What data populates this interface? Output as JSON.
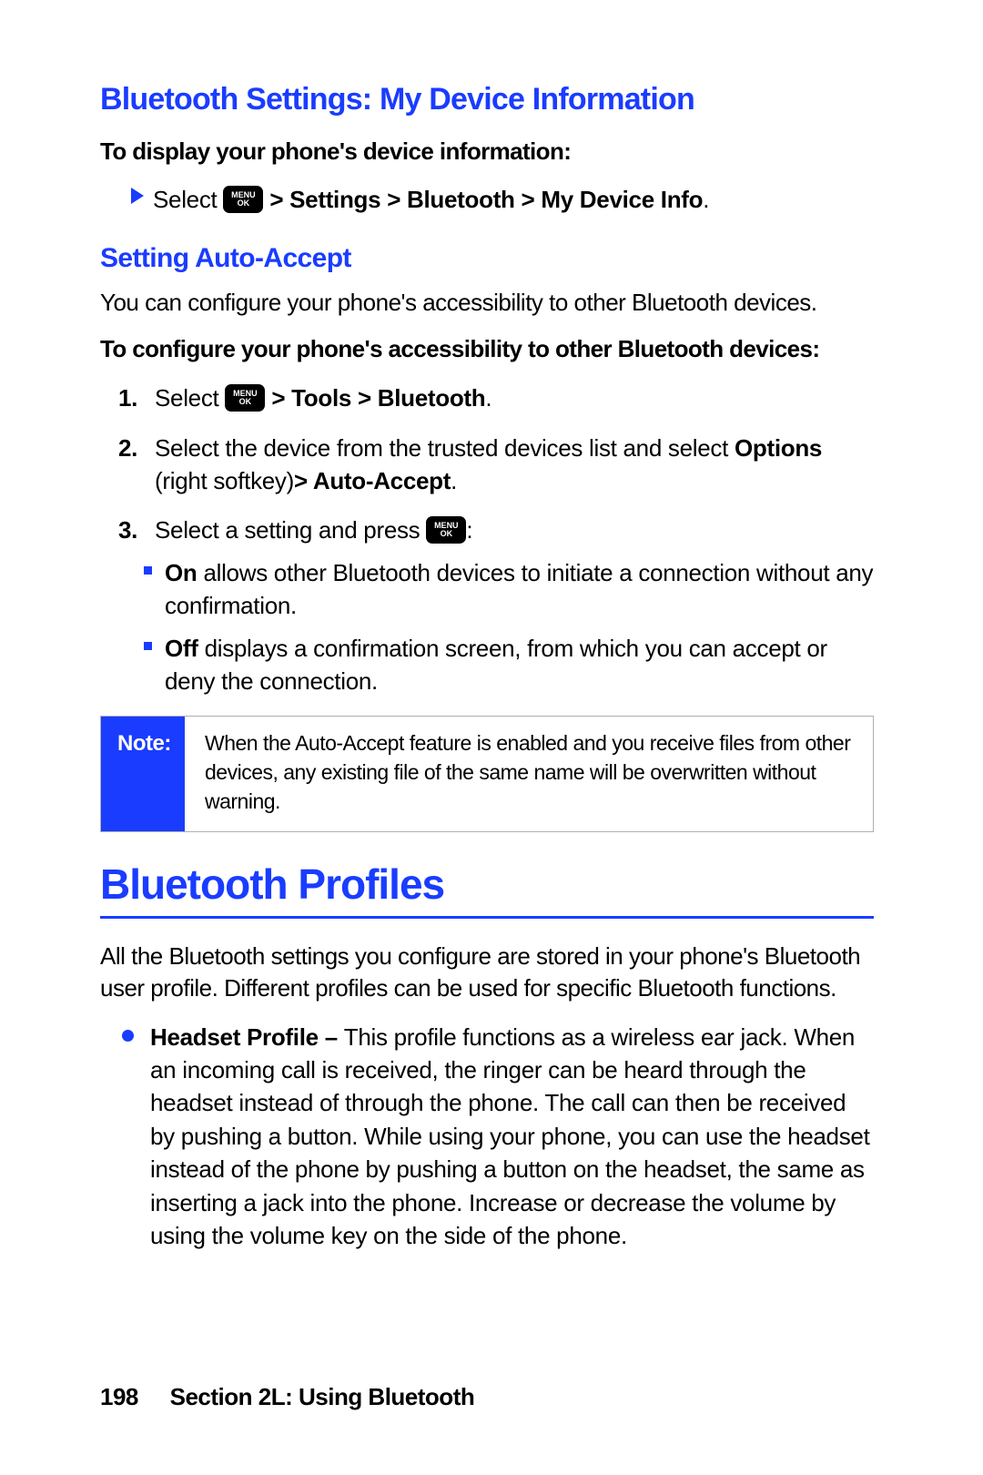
{
  "h2_1": "Bluetooth Settings: My Device Information",
  "sub_1": "To display your phone's device information:",
  "step_select": "Select ",
  "menu_icon": {
    "top": "MENU",
    "bottom": "OK"
  },
  "path_devinfo": " > Settings > Bluetooth > My Device Info",
  "period": ".",
  "h3_1": "Setting Auto-Accept",
  "p_configure_intro": "You can configure your phone's accessibility to other Bluetooth devices.",
  "sub_2": "To configure your phone's accessibility to other Bluetooth devices:",
  "ol": {
    "n1": "1.",
    "n2": "2.",
    "n3": "3.",
    "t1_pre": "Select ",
    "t1_path": " > Tools > Bluetooth",
    "t2_a": "Select the device from the trusted devices list and select ",
    "t2_b": "Options",
    "t2_c": " (right softkey)",
    "t2_d": "> Auto-Accept",
    "t3_a": "Select a setting and press ",
    "t3_c": ":"
  },
  "opts": {
    "on_b": "On",
    "on_t": " allows other Bluetooth devices to initiate a connection without any confirmation.",
    "off_b": "Off",
    "off_t": " displays a confirmation screen, from which you can accept or deny the connection."
  },
  "note": {
    "label": "Note:",
    "body": "When the Auto-Accept feature is enabled and you receive files from other devices, any existing file of the same name will be overwritten without warning."
  },
  "h1": "Bluetooth Profiles",
  "p_profiles": "All the Bluetooth settings you configure are stored in your phone's Bluetooth user profile. Different profiles can be used for specific Bluetooth functions.",
  "profile": {
    "title": "Headset Profile – ",
    "body": "This profile functions as a wireless ear jack. When an incoming call is received, the ringer can be heard through the headset instead of through the phone. The call can then be received by pushing a button. While using your phone, you can use the headset instead of the phone by pushing a button on the headset, the same as inserting a jack into the phone. Increase or decrease the volume by using the volume key on the side of the phone."
  },
  "footer": {
    "page": "198",
    "section": "Section 2L: Using Bluetooth"
  }
}
